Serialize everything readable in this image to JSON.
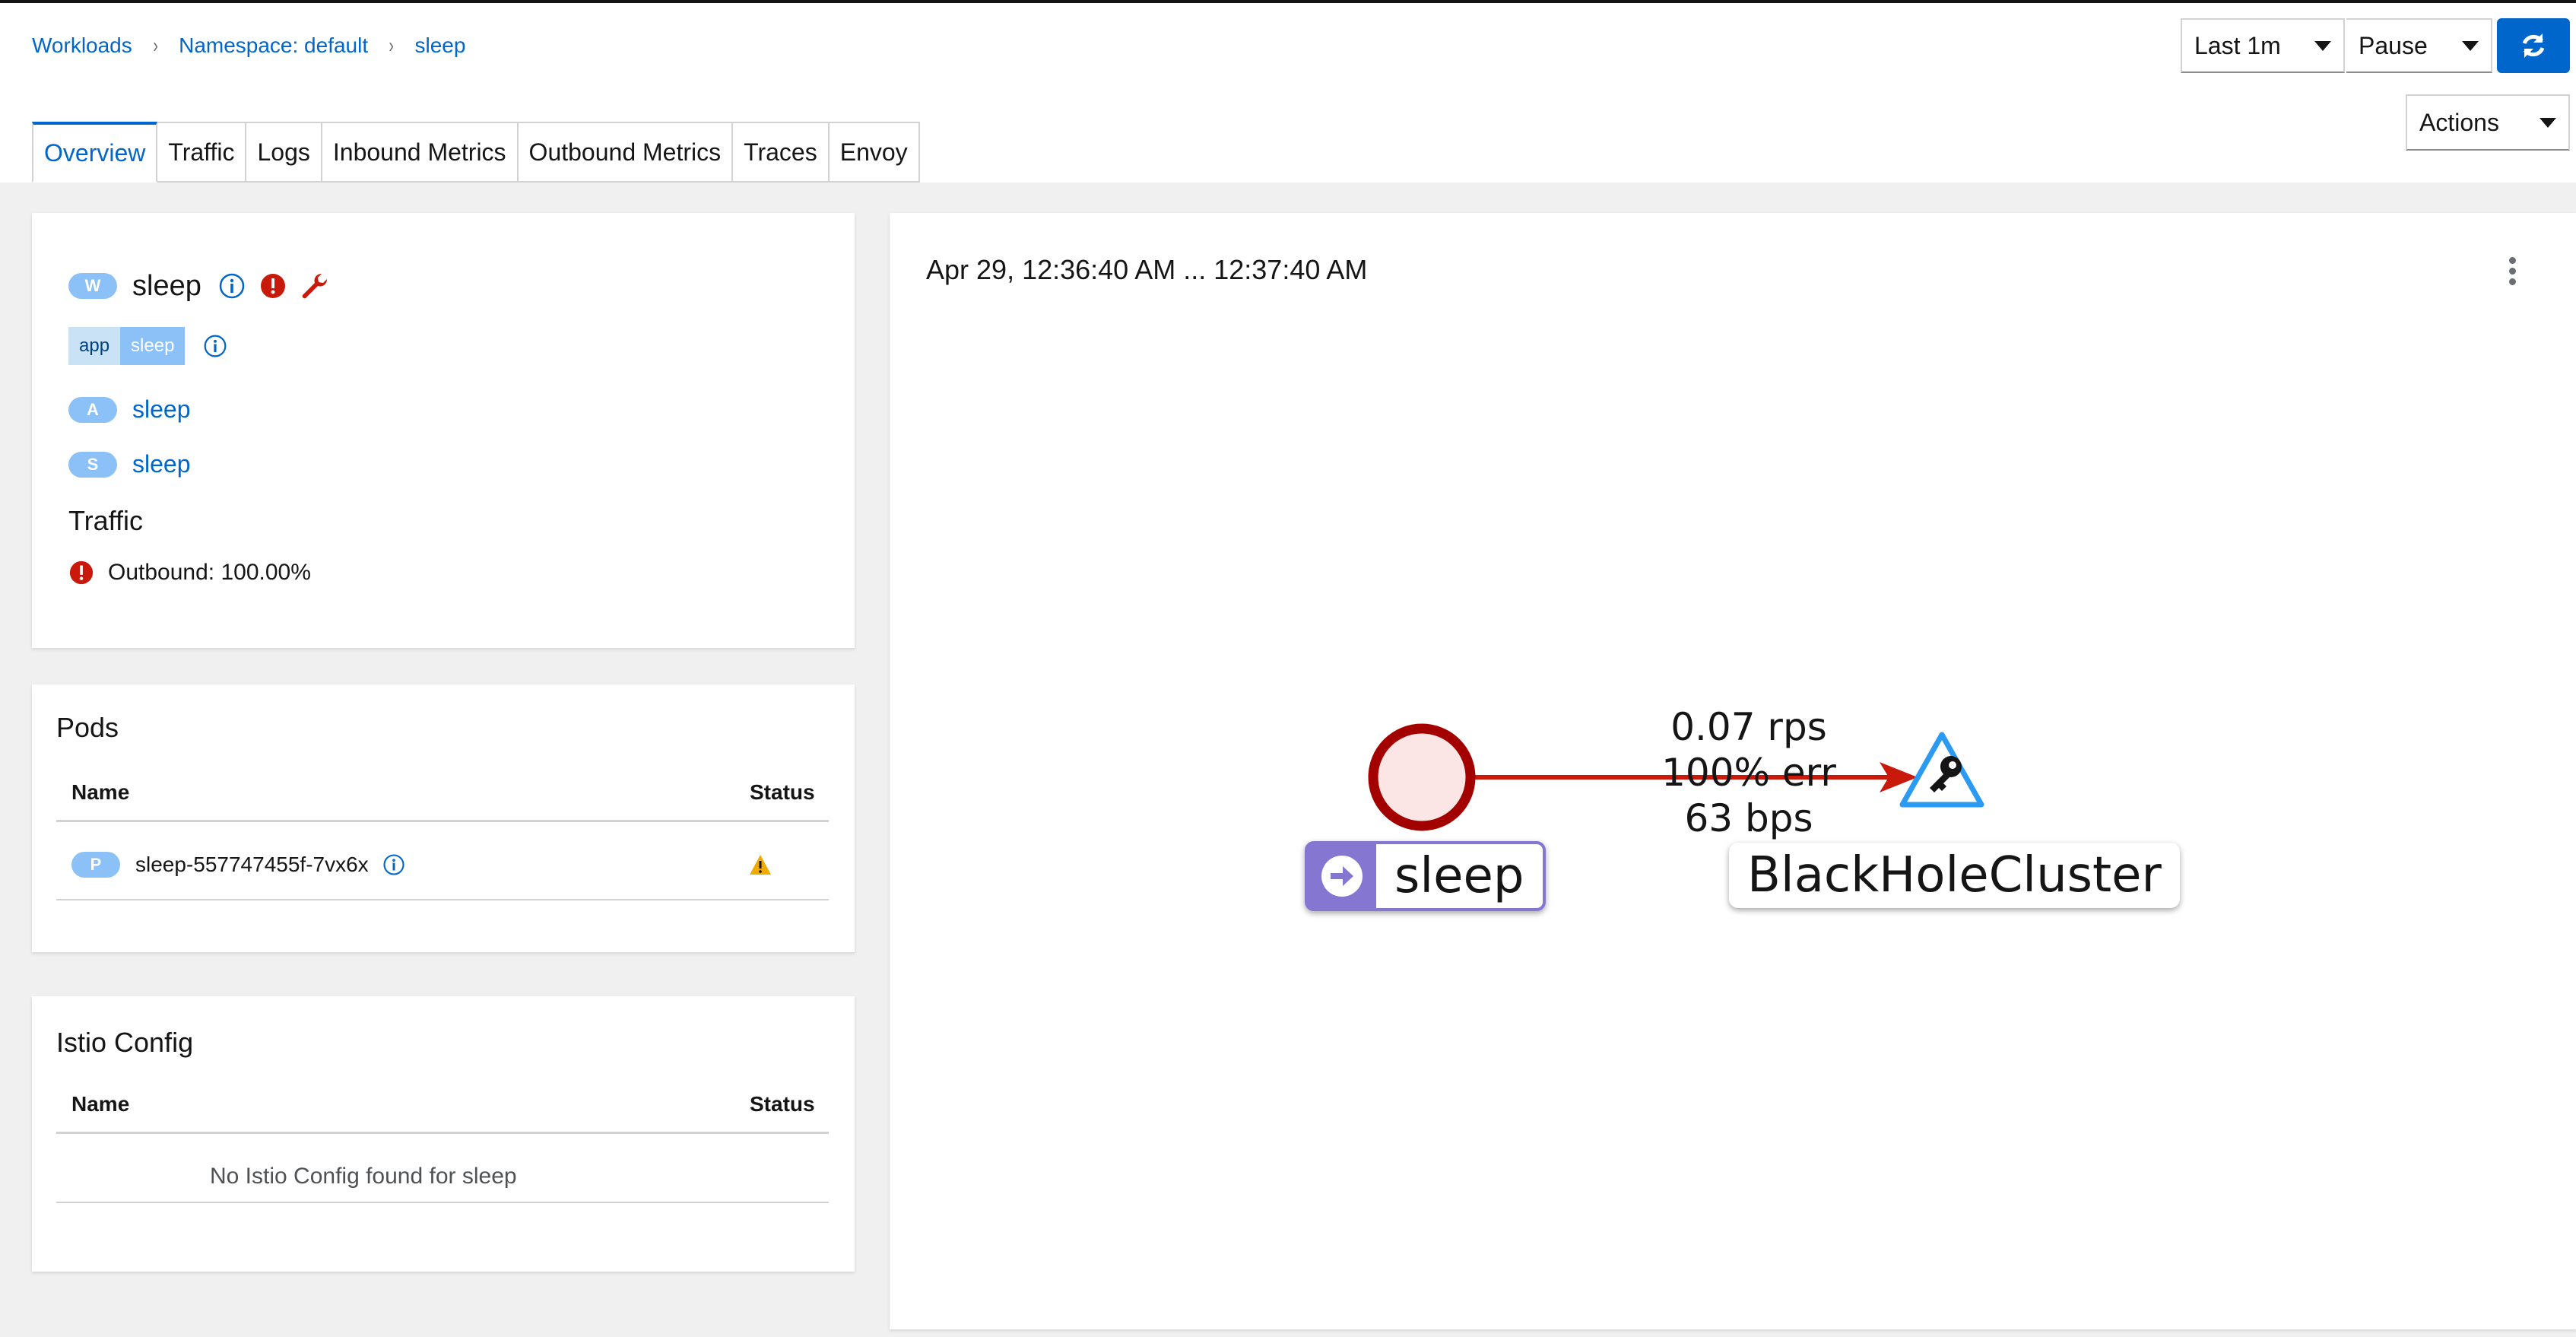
{
  "breadcrumb": {
    "items": [
      "Workloads",
      "Namespace: default",
      "sleep"
    ],
    "separator": "›"
  },
  "controls": {
    "duration": "Last 1m",
    "refresh_interval": "Pause",
    "refresh_icon": "refresh-icon",
    "actions": "Actions"
  },
  "tabs": [
    "Overview",
    "Traffic",
    "Logs",
    "Inbound Metrics",
    "Outbound Metrics",
    "Traces",
    "Envoy"
  ],
  "active_tab": "Overview",
  "workload": {
    "badge": "W",
    "name": "sleep",
    "icons": [
      "info-icon",
      "error-icon",
      "wrench-icon"
    ],
    "label_key": "app",
    "label_value": "sleep",
    "app_badge": "A",
    "app_name": "sleep",
    "service_badge": "S",
    "service_name": "sleep",
    "traffic_heading": "Traffic",
    "traffic_status": "Outbound: 100.00%"
  },
  "pods": {
    "title": "Pods",
    "columns": [
      "Name",
      "Status"
    ],
    "rows": [
      {
        "badge": "P",
        "name": "sleep-557747455f-7vx6x",
        "status_icon": "warning-icon"
      }
    ]
  },
  "istio_config": {
    "title": "Istio Config",
    "columns": [
      "Name",
      "Status"
    ],
    "empty_text": "No Istio Config found for sleep"
  },
  "graph": {
    "time_range": "Apr 29, 12:36:40 AM ... 12:37:40 AM",
    "edge": {
      "rps": "0.07 rps",
      "err": "100% err",
      "bps": "63 bps"
    },
    "source_node": "sleep",
    "target_node": "BlackHoleCluster"
  },
  "colors": {
    "link": "#0066cc",
    "badge": "#8bc1f7",
    "error": "#c9190b",
    "warning": "#f0ab00",
    "graph_edge": "#c9190b",
    "workload_node_border": "#a30000",
    "service_label_accent": "#8476d1"
  }
}
